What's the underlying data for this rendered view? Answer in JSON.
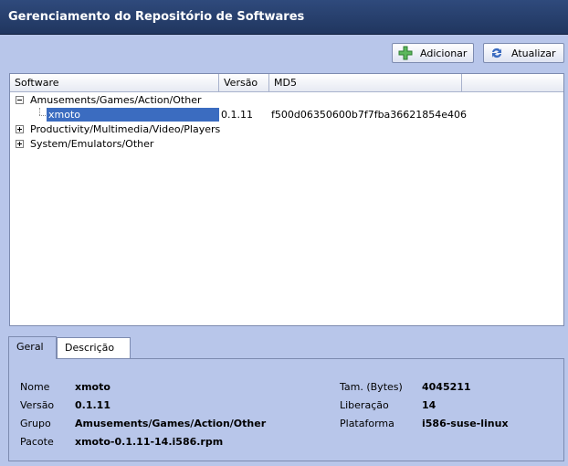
{
  "header": {
    "title": "Gerenciamento do Repositório de Softwares"
  },
  "toolbar": {
    "add_label": "Adicionar",
    "update_label": "Atualizar"
  },
  "table": {
    "columns": [
      "Software",
      "Versão",
      "MD5"
    ],
    "rows": [
      {
        "name": "Amusements/Games/Action/Other",
        "expanded": true
      },
      {
        "name": "xmoto",
        "version": "0.1.11",
        "md5": "f500d06350600b7f7fba36621854e406",
        "selected": true
      },
      {
        "name": "Productivity/Multimedia/Video/Players",
        "expanded": false
      },
      {
        "name": "System/Emulators/Other",
        "expanded": false
      }
    ]
  },
  "tabs": [
    "Geral",
    "Descrição"
  ],
  "details": {
    "name_label": "Nome",
    "name_value": "xmoto",
    "version_label": "Versão",
    "version_value": "0.1.11",
    "group_label": "Grupo",
    "group_value": "Amusements/Games/Action/Other",
    "package_label": "Pacote",
    "package_value": "xmoto-0.1.11-14.i586.rpm",
    "size_label": "Tam. (Bytes)",
    "size_value": "4045211",
    "release_label": "Liberação",
    "release_value": "14",
    "platform_label": "Plataforma",
    "platform_value": "i586-suse-linux"
  },
  "colors": {
    "header": "#263f6b",
    "selection": "#3b6cc0",
    "background": "#b8c6ea"
  },
  "icons": {
    "add": "plus-icon",
    "update": "refresh-icon"
  }
}
